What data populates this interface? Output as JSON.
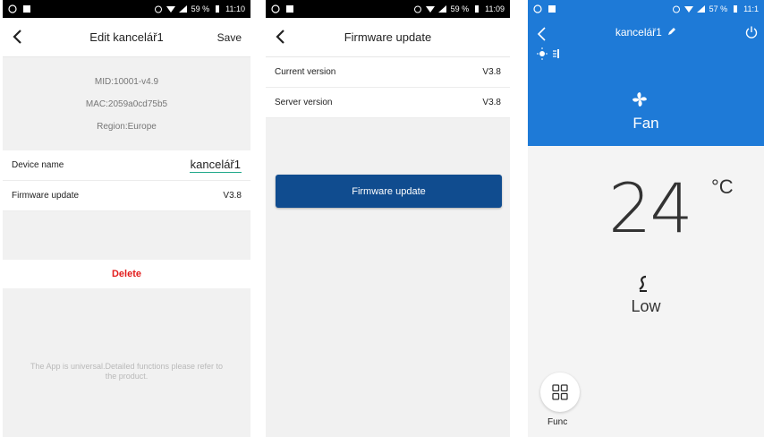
{
  "status_bars": {
    "s1_time": "11:10",
    "s1_battery": "59 %",
    "s2_time": "11:09",
    "s2_battery": "59 %",
    "s3_time": "11:1",
    "s3_battery": "57 %"
  },
  "screen1": {
    "title": "Edit  kancelář1",
    "save_label": "Save",
    "mid": "MID:10001-v4.9",
    "mac": "MAC:2059a0cd75b5",
    "region": "Region:Europe",
    "device_name_label": "Device name",
    "device_name_value": "kancelář1",
    "firmware_label": "Firmware update",
    "firmware_value": "V3.8",
    "delete_label": "Delete",
    "footnote": "The App is universal.Detailed functions please refer to the product."
  },
  "screen2": {
    "title": "Firmware update",
    "current_label": "Current version",
    "current_value": "V3.8",
    "server_label": "Server version",
    "server_value": "V3.8",
    "button_label": "Firmware update"
  },
  "screen3": {
    "title": "kancelář1",
    "mode": "Fan",
    "temperature": "24",
    "unit": "°C",
    "fan_speed": "Low",
    "func_label": "Func"
  },
  "colors": {
    "accent_blue": "#1e7ad7",
    "button_blue": "#104c8f",
    "delete_red": "#e21d1d",
    "input_underline": "#20a98a"
  },
  "icons": [
    "back-icon",
    "edit-pencil-icon",
    "power-icon",
    "fan-mode-icon",
    "fan-speed-icon",
    "grid-icon",
    "sun-icon",
    "signal-icon",
    "wifi-icon",
    "battery-icon",
    "alarm-icon",
    "whatsapp-icon",
    "image-icon"
  ]
}
